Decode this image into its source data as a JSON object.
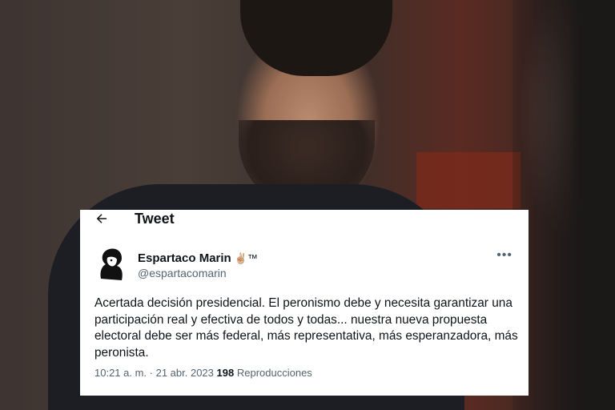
{
  "header": {
    "back_icon": "arrow-left-icon",
    "title": "Tweet"
  },
  "author": {
    "name": "Espartaco Marin",
    "badges": "✌🏼™",
    "handle": "@espartacomarin"
  },
  "menu_icon": "more-horizontal-icon",
  "tweet": {
    "text": "Acertada decisión presidencial. El peronismo debe y necesita garantizar una participación real y efectiva de todos y todas... nuestra nueva propuesta electoral debe ser más federal, más representativa, más esperanzadora, más peronista."
  },
  "meta": {
    "time": "10:21 a. m.",
    "separator": " · ",
    "date": "21 abr. 2023",
    "views_count": "198",
    "views_label": "Reproducciones"
  }
}
